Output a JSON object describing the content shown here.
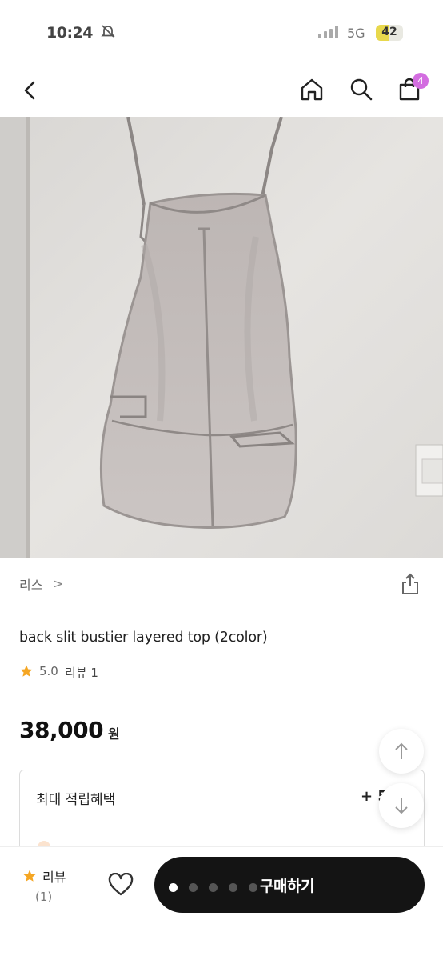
{
  "status_bar": {
    "time": "10:24",
    "network": "5G",
    "battery": "42"
  },
  "header": {
    "cart_count": "4"
  },
  "product": {
    "brand": "리스",
    "brand_chevron": ">",
    "title": "back slit bustier layered top (2color)",
    "rating": "5.0",
    "review_link": "리뷰 1",
    "price": "38,000",
    "currency": "원"
  },
  "benefit": {
    "label": "최대 적립혜택",
    "value": "+ 5"
  },
  "bottom_bar": {
    "review_label": "리뷰",
    "review_count": "(1)",
    "buy_label": "구매하기",
    "page_dots": {
      "count": 5,
      "active": 0
    }
  },
  "colors": {
    "badge": "#d36de0",
    "star": "#f5a623",
    "buy_button": "#141414"
  }
}
